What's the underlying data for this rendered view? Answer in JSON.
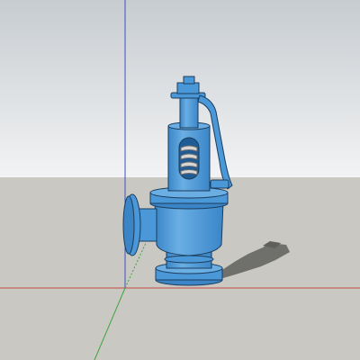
{
  "viewport": {
    "sky_top_color": "#c7ccd0",
    "sky_bottom_color": "#f2f3f4",
    "ground_color": "#c9c8c3",
    "valve_color": "#4a98d8",
    "valve_light_color": "#7bb9ea",
    "valve_dark_color": "#2f73b4",
    "outline_color": "#1c3d5c",
    "shadow_color": "#5f5f5c",
    "red_axis_color": "#c44a4a",
    "green_axis_color": "#3ea33e",
    "blue_axis_color": "#3f4fbf"
  },
  "model": {
    "icon": "safety-valve-3d-model-icon"
  }
}
